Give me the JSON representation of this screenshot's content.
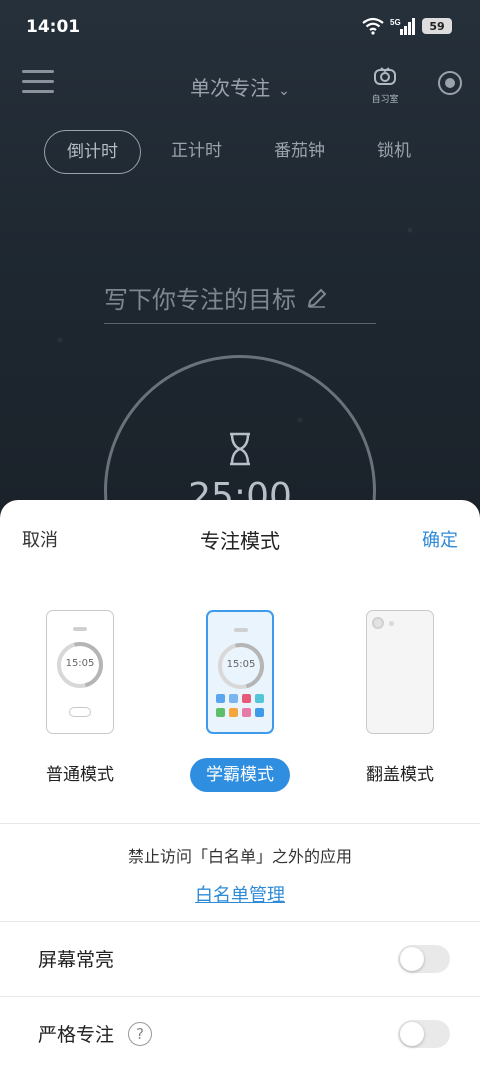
{
  "status_bar": {
    "time": "14:01",
    "network": "5G",
    "battery": "59"
  },
  "header": {
    "mode_title": "单次专注",
    "room_label": "自习室"
  },
  "tabs": [
    {
      "label": "倒计时",
      "active": true
    },
    {
      "label": "正计时",
      "active": false
    },
    {
      "label": "番茄钟",
      "active": false
    },
    {
      "label": "锁机",
      "active": false
    }
  ],
  "goal": {
    "placeholder": "写下你专注的目标"
  },
  "timer": {
    "value": "25:00"
  },
  "sheet": {
    "cancel_label": "取消",
    "title": "专注模式",
    "confirm_label": "确定",
    "modes": [
      {
        "label": "普通模式",
        "preview_time": "15:05",
        "selected": false
      },
      {
        "label": "学霸模式",
        "preview_time": "15:05",
        "selected": true
      },
      {
        "label": "翻盖模式",
        "selected": false
      }
    ],
    "description": "禁止访问「白名单」之外的应用",
    "whitelist_link": "白名单管理",
    "settings": [
      {
        "label": "屏幕常亮",
        "enabled": false
      },
      {
        "label": "严格专注",
        "enabled": false,
        "help": "?"
      }
    ]
  },
  "colors": {
    "accent": "#2f8ee0",
    "link": "#2f8bd8"
  }
}
